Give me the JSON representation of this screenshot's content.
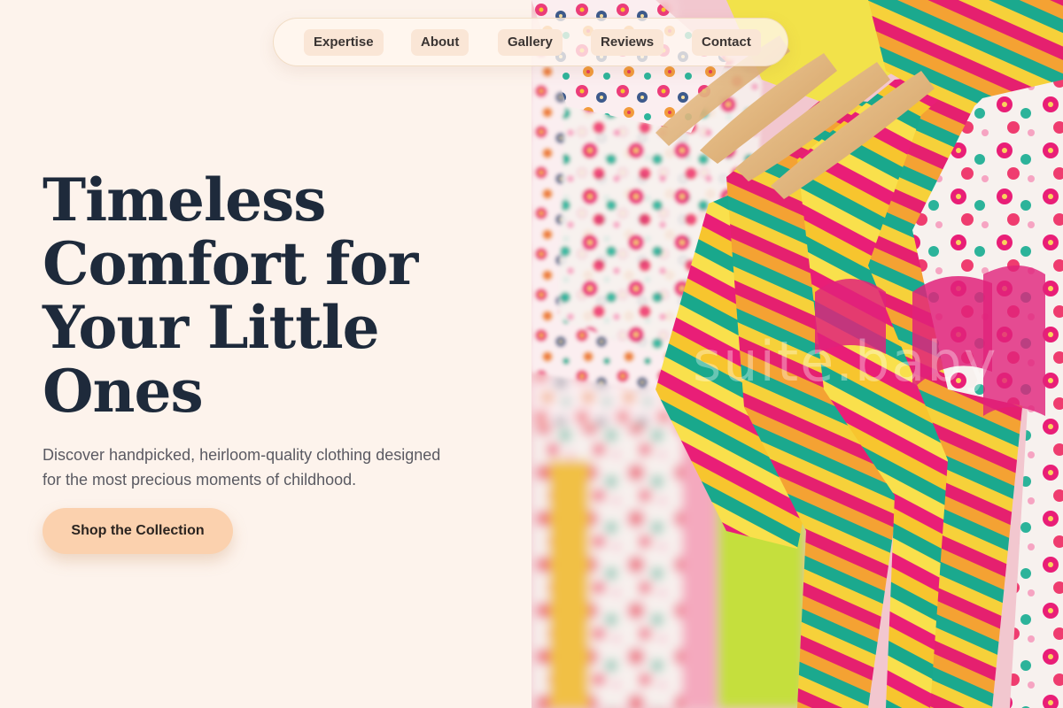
{
  "nav": {
    "items": [
      {
        "label": "Expertise"
      },
      {
        "label": "About"
      },
      {
        "label": "Gallery"
      },
      {
        "label": "Reviews"
      },
      {
        "label": "Contact"
      }
    ]
  },
  "hero": {
    "title_lines": [
      "Timeless",
      "Comfort for",
      "Your Little",
      "Ones"
    ],
    "subtitle_lines": [
      "Discover handpicked, heirloom-quality clothing designed",
      "for the most precious moments of childhood."
    ],
    "cta_label": "Shop the Collection"
  },
  "image": {
    "subject": "striped and floral children's clothes hanging on wooden hangers",
    "watermark": "suite.baby"
  },
  "colors": {
    "background": "#fdf3ec",
    "heading": "#1e2a3b",
    "body_text": "#5a5a62",
    "cta_bg": "#fbd1ae",
    "nav_item_bg": "#fae6d6"
  }
}
